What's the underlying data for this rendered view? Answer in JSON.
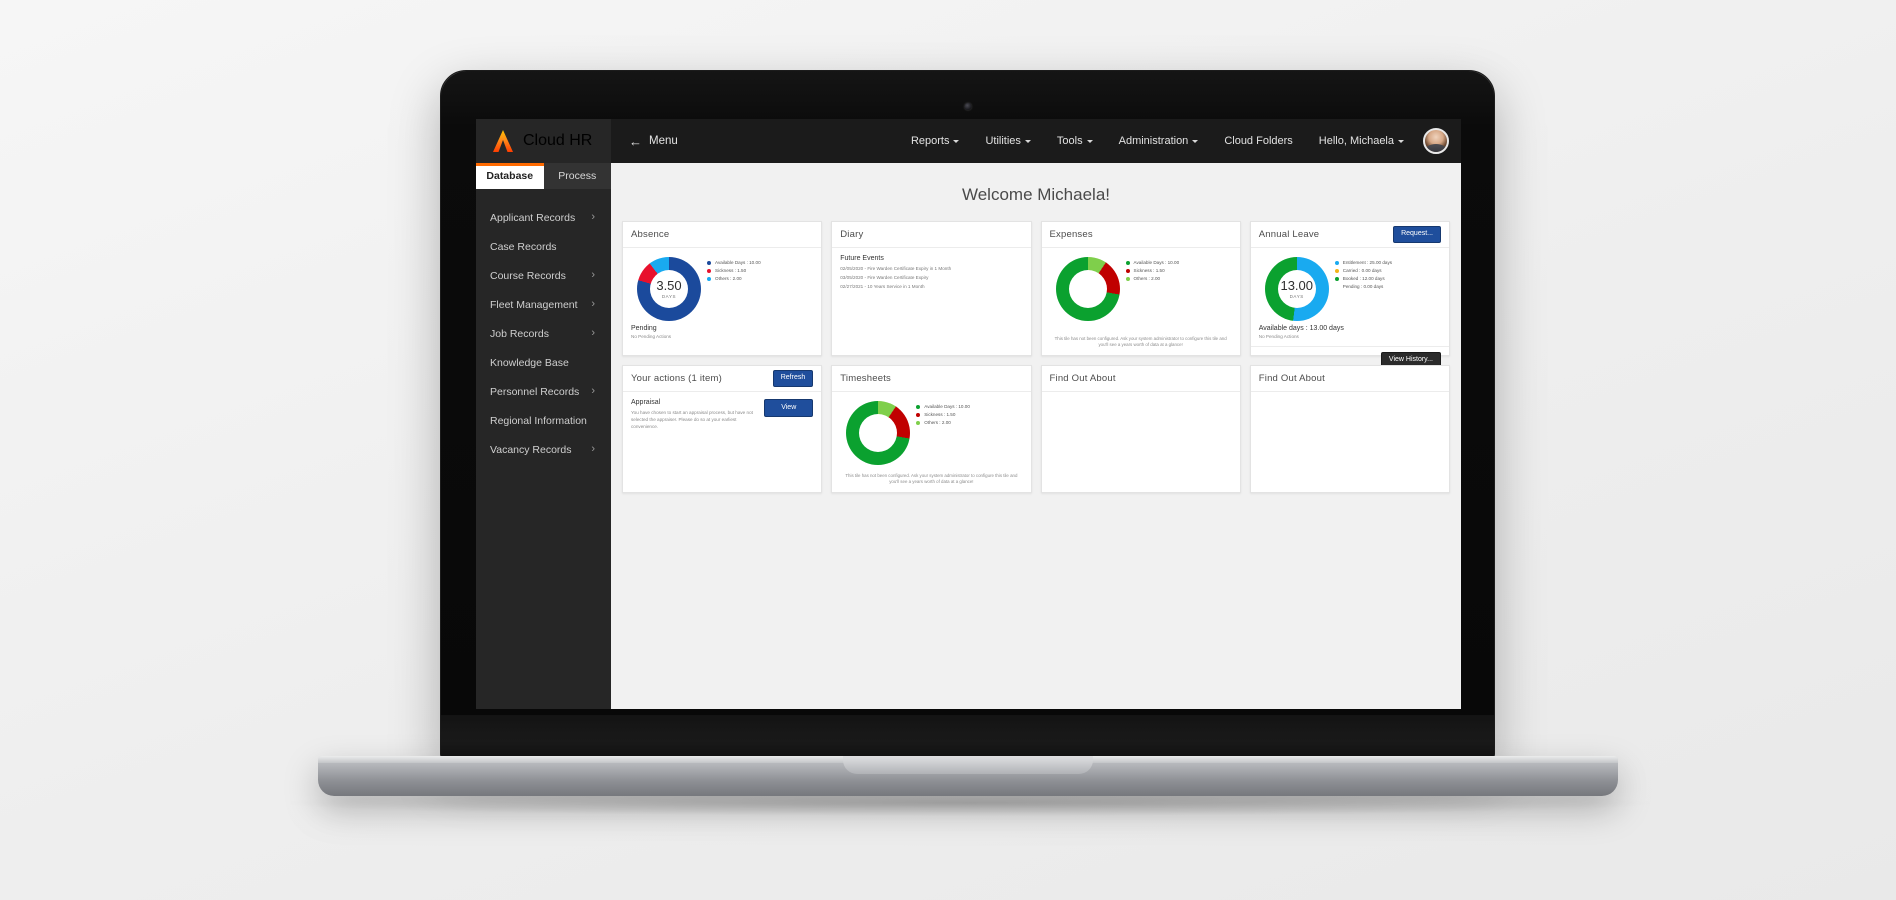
{
  "brand": {
    "name": "Cloud HR",
    "logo_icon": "peak-logo-icon",
    "accent_color": "#ff6a00"
  },
  "topbar": {
    "menu_label": "Menu",
    "menu_arrow_icon": "arrow-left-icon",
    "nav_items": [
      {
        "label": "Reports",
        "has_caret": true
      },
      {
        "label": "Utilities",
        "has_caret": true
      },
      {
        "label": "Tools",
        "has_caret": true
      },
      {
        "label": "Administration",
        "has_caret": true
      },
      {
        "label": "Cloud Folders",
        "has_caret": false
      },
      {
        "label": "Hello, Michaela",
        "has_caret": true
      }
    ],
    "avatar_icon": "user-avatar"
  },
  "sidebar": {
    "tabs": [
      {
        "label": "Database",
        "active": true
      },
      {
        "label": "Process",
        "active": false
      }
    ],
    "items": [
      {
        "label": "Applicant Records",
        "chevron": true
      },
      {
        "label": "Case Records",
        "chevron": false
      },
      {
        "label": "Course Records",
        "chevron": true
      },
      {
        "label": "Fleet Management",
        "chevron": true
      },
      {
        "label": "Job Records",
        "chevron": true
      },
      {
        "label": "Knowledge Base",
        "chevron": false
      },
      {
        "label": "Personnel Records",
        "chevron": true
      },
      {
        "label": "Regional Information",
        "chevron": false
      },
      {
        "label": "Vacancy Records",
        "chevron": true
      }
    ],
    "chevron_icon": "chevron-right-icon"
  },
  "main": {
    "welcome": "Welcome Michaela!"
  },
  "cards": {
    "absence": {
      "title": "Absence",
      "value": "3.50",
      "unit": "DAYS",
      "pending_title": "Pending",
      "pending_note": "No Pending Actions",
      "legend": [
        {
          "label": "Available Days : 10.00",
          "color": "#1b4a9c"
        },
        {
          "label": "Sickness : 1.50",
          "color": "#e8112d"
        },
        {
          "label": "Others : 2.00",
          "color": "#19aaf0"
        }
      ]
    },
    "diary": {
      "title": "Diary",
      "section": "Future Events",
      "events": [
        "02/05/2020 - Fire Warden Certificate Expiry in 1 Month",
        "03/05/2020 - Fire Warden Certificate Expiry",
        "02/27/2021 - 10 Years Service in 1 Month"
      ]
    },
    "expenses": {
      "title": "Expenses",
      "note": "This tile has not been configured. Ask your system administrator to configure this tile and you'll see a years worth of data at a glance!",
      "legend": [
        {
          "label": "Available Days : 10.00",
          "color": "#0ba12f"
        },
        {
          "label": "Sickness : 1.50",
          "color": "#c00000"
        },
        {
          "label": "Others : 2.00",
          "color": "#7fcf4b"
        }
      ]
    },
    "annual_leave": {
      "title": "Annual Leave",
      "request_button": "Request...",
      "history_button": "View History...",
      "value": "13.00",
      "unit": "DAYS",
      "available_line": "Available days : 13.00 days",
      "pending_note": "No Pending Actions",
      "legend": [
        {
          "label": "Entitlement : 25.00 days",
          "color": "#19aaf0"
        },
        {
          "label": "Carried : 0.00 days",
          "color": "#f3b418"
        },
        {
          "label": "Booked : 12.00 days",
          "color": "#0ba12f"
        },
        {
          "label": "Pending : 0.00 days",
          "color": ""
        }
      ]
    },
    "your_actions": {
      "title": "Your actions (1 item)",
      "refresh_button": "Refresh",
      "item_title": "Appraisal",
      "item_desc": "You have chosen to start an appraisal process, but have not selected the appraiser. Please do so at your earliest convenience.",
      "view_button": "View"
    },
    "timesheets": {
      "title": "Timesheets",
      "note": "This tile has not been configured. Ask your system administrator to configure this tile and you'll see a years worth of data at a glance!",
      "legend": [
        {
          "label": "Available Days : 10.00",
          "color": "#0ba12f"
        },
        {
          "label": "Sickness : 1.50",
          "color": "#c00000"
        },
        {
          "label": "Others : 2.00",
          "color": "#7fcf4b"
        }
      ]
    },
    "find_out_about_1": {
      "title": "Find Out About"
    },
    "find_out_about_2": {
      "title": "Find Out About"
    }
  },
  "chart_data": [
    {
      "type": "pie",
      "title": "Absence",
      "center_label": "3.50",
      "center_unit": "DAYS",
      "labels": [
        "Available Days",
        "Sickness",
        "Others"
      ],
      "values": [
        10.0,
        1.5,
        2.0
      ],
      "colors": [
        "#1b4a9c",
        "#e8112d",
        "#19aaf0"
      ],
      "legend_position": "right"
    },
    {
      "type": "pie",
      "title": "Expenses",
      "labels": [
        "Available Days",
        "Sickness",
        "Others"
      ],
      "values": [
        10.0,
        1.5,
        2.0
      ],
      "colors": [
        "#0ba12f",
        "#c00000",
        "#7fcf4b"
      ],
      "legend_position": "right"
    },
    {
      "type": "pie",
      "title": "Annual Leave",
      "center_label": "13.00",
      "center_unit": "DAYS",
      "labels": [
        "Entitlement",
        "Carried",
        "Booked",
        "Pending"
      ],
      "values": [
        25.0,
        0.0,
        12.0,
        0.0
      ],
      "colors": [
        "#19aaf0",
        "#f3b418",
        "#0ba12f",
        "#cccccc"
      ],
      "legend_position": "right"
    },
    {
      "type": "pie",
      "title": "Timesheets",
      "labels": [
        "Available Days",
        "Sickness",
        "Others"
      ],
      "values": [
        10.0,
        1.5,
        2.0
      ],
      "colors": [
        "#0ba12f",
        "#c00000",
        "#7fcf4b"
      ],
      "legend_position": "right"
    }
  ]
}
